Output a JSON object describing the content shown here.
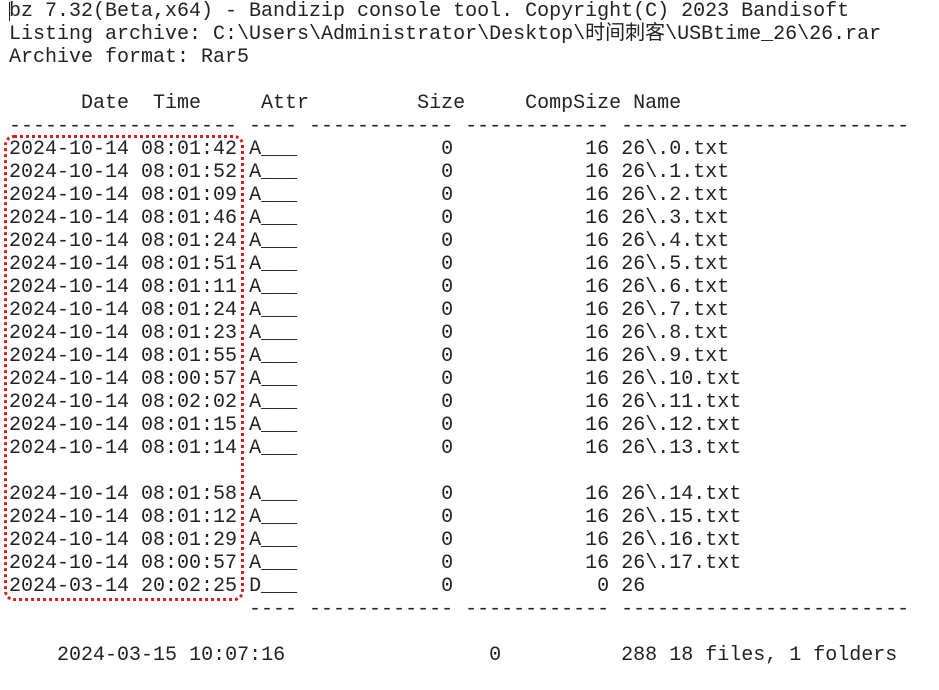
{
  "header": {
    "title_line": "bz 7.32(Beta,x64) - Bandizip console tool. Copyright(C) 2023 Bandisoft",
    "listing_line": "Listing archive: C:\\Users\\Administrator\\Desktop\\时间刺客\\USBtime_26\\26.rar",
    "format_line": "Archive format: Rar5"
  },
  "columns": {
    "header_line": "      Date  Time     Attr         Size     CompSize Name",
    "separator_line": "------------------- ---- ------------ ------------ ------------------------"
  },
  "rows": [
    {
      "date": "2024-10-14",
      "time": "08:01:42",
      "attr": "A___",
      "size": "0",
      "compsize": "16",
      "name": "26\\.0.txt"
    },
    {
      "date": "2024-10-14",
      "time": "08:01:52",
      "attr": "A___",
      "size": "0",
      "compsize": "16",
      "name": "26\\.1.txt"
    },
    {
      "date": "2024-10-14",
      "time": "08:01:09",
      "attr": "A___",
      "size": "0",
      "compsize": "16",
      "name": "26\\.2.txt"
    },
    {
      "date": "2024-10-14",
      "time": "08:01:46",
      "attr": "A___",
      "size": "0",
      "compsize": "16",
      "name": "26\\.3.txt"
    },
    {
      "date": "2024-10-14",
      "time": "08:01:24",
      "attr": "A___",
      "size": "0",
      "compsize": "16",
      "name": "26\\.4.txt"
    },
    {
      "date": "2024-10-14",
      "time": "08:01:51",
      "attr": "A___",
      "size": "0",
      "compsize": "16",
      "name": "26\\.5.txt"
    },
    {
      "date": "2024-10-14",
      "time": "08:01:11",
      "attr": "A___",
      "size": "0",
      "compsize": "16",
      "name": "26\\.6.txt"
    },
    {
      "date": "2024-10-14",
      "time": "08:01:24",
      "attr": "A___",
      "size": "0",
      "compsize": "16",
      "name": "26\\.7.txt"
    },
    {
      "date": "2024-10-14",
      "time": "08:01:23",
      "attr": "A___",
      "size": "0",
      "compsize": "16",
      "name": "26\\.8.txt"
    },
    {
      "date": "2024-10-14",
      "time": "08:01:55",
      "attr": "A___",
      "size": "0",
      "compsize": "16",
      "name": "26\\.9.txt"
    },
    {
      "date": "2024-10-14",
      "time": "08:00:57",
      "attr": "A___",
      "size": "0",
      "compsize": "16",
      "name": "26\\.10.txt"
    },
    {
      "date": "2024-10-14",
      "time": "08:02:02",
      "attr": "A___",
      "size": "0",
      "compsize": "16",
      "name": "26\\.11.txt"
    },
    {
      "date": "2024-10-14",
      "time": "08:01:15",
      "attr": "A___",
      "size": "0",
      "compsize": "16",
      "name": "26\\.12.txt"
    },
    {
      "date": "2024-10-14",
      "time": "08:01:14",
      "attr": "A___",
      "size": "0",
      "compsize": "16",
      "name": "26\\.13.txt"
    },
    null,
    {
      "date": "2024-10-14",
      "time": "08:01:58",
      "attr": "A___",
      "size": "0",
      "compsize": "16",
      "name": "26\\.14.txt"
    },
    {
      "date": "2024-10-14",
      "time": "08:01:12",
      "attr": "A___",
      "size": "0",
      "compsize": "16",
      "name": "26\\.15.txt"
    },
    {
      "date": "2024-10-14",
      "time": "08:01:29",
      "attr": "A___",
      "size": "0",
      "compsize": "16",
      "name": "26\\.16.txt"
    },
    {
      "date": "2024-10-14",
      "time": "08:00:57",
      "attr": "A___",
      "size": "0",
      "compsize": "16",
      "name": "26\\.17.txt"
    },
    {
      "date": "2024-03-14",
      "time": "20:02:25",
      "attr": "D___",
      "size": "0",
      "compsize": "0",
      "name": "26"
    }
  ],
  "footer": {
    "separator_line": "                    ---- ------------ ------------ ------------------------",
    "date": "2024-03-15",
    "time": "10:07:16",
    "size": "0",
    "compsize": "288",
    "summary": "18 files, 1 folders"
  },
  "colors": {
    "text": "#222222",
    "background": "#ffffff",
    "highlight_border": "#d81e1e"
  }
}
